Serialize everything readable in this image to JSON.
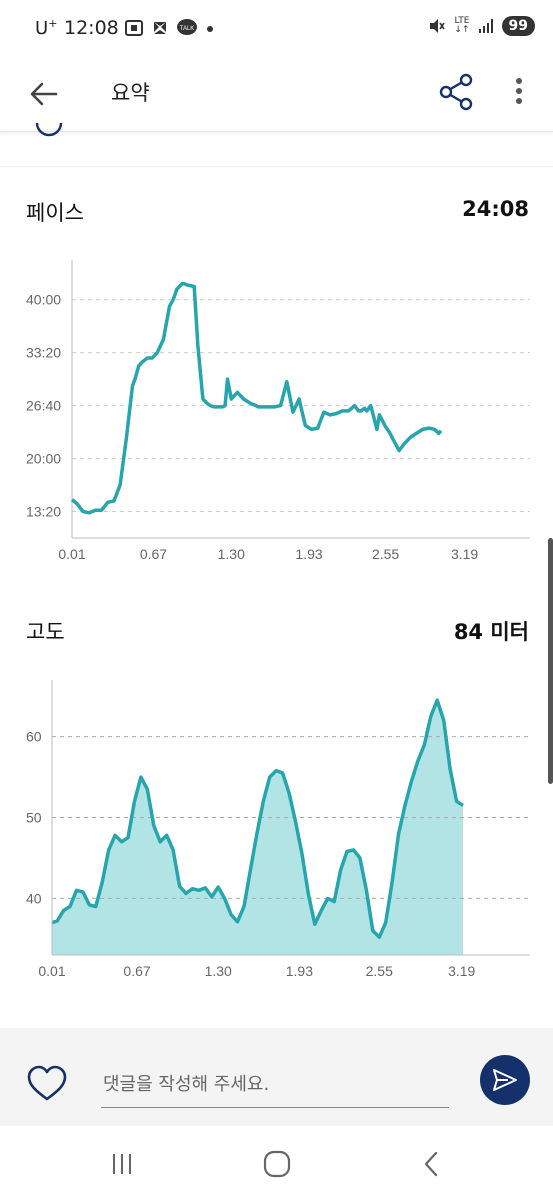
{
  "status_bar": {
    "carrier": "U",
    "carrier_sup": "+",
    "time": "12:08",
    "network": "LTE",
    "battery": "99"
  },
  "app_bar": {
    "title": "요약",
    "icons": [
      "back-arrow-icon",
      "share-icon",
      "more-vert-icon"
    ]
  },
  "pace": {
    "title": "페이스",
    "value": "24:08"
  },
  "elevation": {
    "title": "고도",
    "value": "84 미터"
  },
  "comment": {
    "placeholder": "댓글을 작성해 주세요."
  },
  "colors": {
    "line": "#26a6ac",
    "area_fill": "#b2e3e5",
    "send_button": "#14316b",
    "grid": "#cccccc"
  },
  "chart_data": [
    {
      "type": "line",
      "title": "",
      "xlabel": "",
      "ylabel": "",
      "x_ticks": [
        "0.01",
        "0.67",
        "1.30",
        "1.93",
        "2.55",
        "3.19"
      ],
      "y_ticks": [
        "13:20",
        "20:00",
        "26:40",
        "33:20",
        "40:00"
      ],
      "ylim_seconds": [
        600,
        2700
      ],
      "xlim": [
        0.01,
        3.72
      ],
      "grid": true,
      "x": [
        0.01,
        0.05,
        0.1,
        0.15,
        0.2,
        0.25,
        0.3,
        0.35,
        0.4,
        0.45,
        0.5,
        0.52,
        0.55,
        0.58,
        0.62,
        0.66,
        0.7,
        0.75,
        0.8,
        0.83,
        0.86,
        0.88,
        0.9,
        0.92,
        0.95,
        1.0,
        1.03,
        1.07,
        1.1,
        1.13,
        1.16,
        1.2,
        1.23,
        1.25,
        1.27,
        1.3,
        1.35,
        1.4,
        1.45,
        1.5,
        1.52,
        1.54,
        1.56,
        1.58,
        1.6,
        1.62,
        1.65,
        1.7,
        1.75,
        1.8,
        1.85,
        1.9,
        1.95,
        2.0,
        2.05,
        2.1,
        2.15,
        2.2,
        2.25,
        2.3,
        2.33,
        2.35,
        2.38,
        2.4,
        2.43,
        2.45,
        2.48,
        2.5,
        2.55,
        2.58,
        2.62,
        2.66,
        2.7,
        2.75,
        2.8,
        2.85,
        2.9,
        2.95,
        2.98,
        3.0,
        3.05,
        3.1,
        3.15,
        3.18,
        3.22,
        3.25,
        3.3,
        3.35,
        3.4,
        3.45,
        3.5,
        3.55,
        3.6,
        3.65,
        3.68,
        3.7,
        3.72
      ],
      "y_seconds": [
        890,
        860,
        800,
        790,
        810,
        810,
        870,
        880,
        1000,
        1350,
        1750,
        1800,
        1900,
        1930,
        1960,
        1960,
        2000,
        2100,
        2350,
        2400,
        2480,
        2500,
        2520,
        2520,
        2510,
        2500,
        2050,
        1650,
        1620,
        1600,
        1590,
        1590,
        1590,
        1600,
        1800,
        1650,
        1700,
        1650,
        1620,
        1600,
        1590,
        1590,
        1590,
        1590,
        1590,
        1590,
        1590,
        1600,
        1780,
        1550,
        1650,
        1450,
        1420,
        1430,
        1550,
        1530,
        1540,
        1560,
        1560,
        1600,
        1560,
        1560,
        1580,
        1560,
        1600,
        1530,
        1420,
        1530,
        1440,
        1400,
        1330,
        1260,
        1310,
        1360,
        1390,
        1420,
        1430,
        1420,
        1390,
        1410
      ],
      "series_name": ""
    },
    {
      "type": "area",
      "title": "",
      "xlabel": "",
      "ylabel": "",
      "x_ticks": [
        "0.01",
        "0.67",
        "1.30",
        "1.93",
        "2.55",
        "3.19"
      ],
      "y_ticks": [
        "40",
        "50",
        "60"
      ],
      "ylim": [
        33,
        67
      ],
      "xlim": [
        0.01,
        3.72
      ],
      "grid": true,
      "x": [
        0.01,
        0.05,
        0.1,
        0.15,
        0.2,
        0.25,
        0.3,
        0.35,
        0.4,
        0.45,
        0.5,
        0.55,
        0.6,
        0.65,
        0.7,
        0.75,
        0.8,
        0.85,
        0.9,
        0.95,
        1.0,
        1.05,
        1.1,
        1.15,
        1.2,
        1.25,
        1.3,
        1.35,
        1.4,
        1.45,
        1.5,
        1.55,
        1.6,
        1.65,
        1.7,
        1.75,
        1.8,
        1.85,
        1.9,
        1.95,
        2.0,
        2.05,
        2.1,
        2.15,
        2.2,
        2.25,
        2.3,
        2.35,
        2.4,
        2.45,
        2.5,
        2.55,
        2.6,
        2.65,
        2.7,
        2.75,
        2.8,
        2.85,
        2.9,
        2.95,
        3.0,
        3.05,
        3.1,
        3.15,
        3.2,
        3.25,
        3.3,
        3.35,
        3.4,
        3.45,
        3.5,
        3.55,
        3.6,
        3.65,
        3.7,
        3.72
      ],
      "y": [
        37.0,
        37.2,
        38.5,
        39.0,
        41.0,
        40.8,
        39.2,
        39.0,
        42.0,
        46.0,
        47.8,
        47.0,
        47.5,
        52.0,
        55.0,
        53.5,
        49.0,
        47.0,
        47.8,
        46.0,
        41.5,
        40.6,
        41.2,
        41.0,
        41.3,
        40.2,
        41.4,
        40.0,
        38.0,
        37.1,
        39.0,
        43.5,
        48.0,
        52.0,
        55.0,
        55.8,
        55.5,
        53.0,
        49.5,
        45.5,
        40.5,
        36.8,
        38.5,
        40.0,
        39.6,
        43.5,
        45.8,
        46.0,
        45.0,
        41.0,
        36.0,
        35.2,
        37.0,
        42.0,
        48.0,
        51.5,
        54.5,
        57.0,
        59.0,
        62.5,
        64.5,
        62.0,
        56.0,
        52.0,
        51.5
      ],
      "series_name": ""
    }
  ]
}
